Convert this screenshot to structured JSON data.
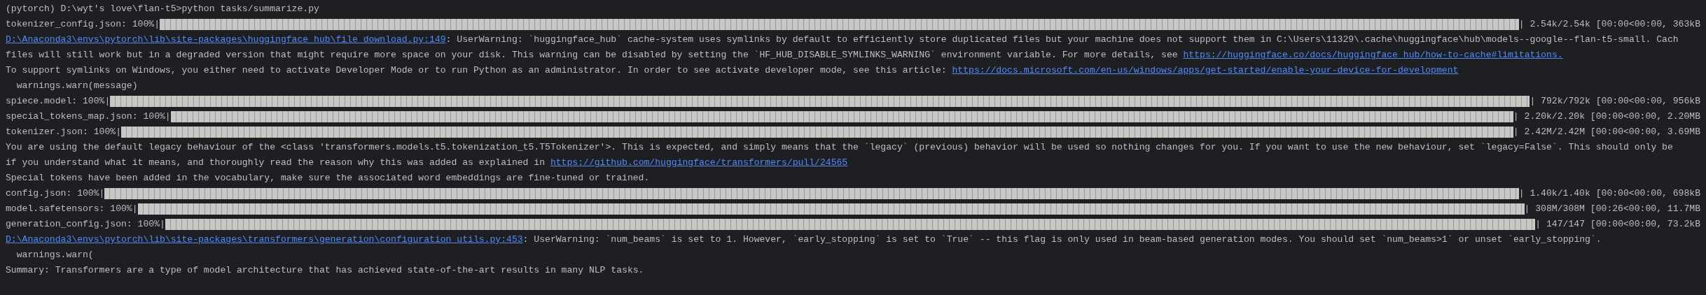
{
  "terminal": {
    "lines": [
      {
        "kind": "text",
        "segments": [
          {
            "kind": "plain",
            "text": "(pytorch) D:\\wyt's love\\flan-t5>python tasks/summarize.py"
          }
        ]
      },
      {
        "kind": "progress",
        "label": "tokenizer_config.json: 100%|",
        "level": 1,
        "stats": "| 2.54k/2.54k [00:00<00:00, 363kB"
      },
      {
        "kind": "text",
        "segments": [
          {
            "kind": "link",
            "text": "D:\\Anaconda3\\envs\\pytorch\\lib\\site-packages\\huggingface_hub\\file_download.py:149"
          },
          {
            "kind": "plain",
            "text": ": UserWarning: `huggingface_hub` cache-system uses symlinks by default to efficiently store duplicated files but your machine does not support them in C:\\Users\\11329\\.cache\\huggingface\\hub\\models--google--flan-t5-small. Cach"
          }
        ]
      },
      {
        "kind": "text",
        "segments": [
          {
            "kind": "plain",
            "text": "files will still work but in a degraded version that might require more space on your disk. This warning can be disabled by setting the `HF_HUB_DISABLE_SYMLINKS_WARNING` environment variable. For more details, see "
          },
          {
            "kind": "link",
            "text": "https://huggingface.co/docs/huggingface_hub/how-to-cache#limitations."
          }
        ]
      },
      {
        "kind": "text",
        "segments": [
          {
            "kind": "plain",
            "text": "To support symlinks on Windows, you either need to activate Developer Mode or to run Python as an administrator. In order to see activate developer mode, see this article: "
          },
          {
            "kind": "link",
            "text": "https://docs.microsoft.com/en-us/windows/apps/get-started/enable-your-device-for-development"
          }
        ]
      },
      {
        "kind": "text",
        "segments": [
          {
            "kind": "plain",
            "text": "  warnings.warn(message)"
          }
        ]
      },
      {
        "kind": "progress",
        "label": "spiece.model: 100%|",
        "level": 1,
        "stats": "| 792k/792k [00:00<00:00, 956kB"
      },
      {
        "kind": "progress",
        "label": "special_tokens_map.json: 100%|",
        "level": 1,
        "stats": "| 2.20k/2.20k [00:00<00:00, 2.20MB"
      },
      {
        "kind": "progress",
        "label": "tokenizer.json: 100%|",
        "level": 1,
        "stats": "| 2.42M/2.42M [00:00<00:00, 3.69MB"
      },
      {
        "kind": "text",
        "segments": [
          {
            "kind": "plain",
            "text": "You are using the default legacy behaviour of the <class 'transformers.models.t5.tokenization_t5.T5Tokenizer'>. This is expected, and simply means that the `legacy` (previous) behavior will be used so nothing changes for you. If you want to use the new behaviour, set `legacy=False`. This should only be"
          }
        ]
      },
      {
        "kind": "text",
        "segments": [
          {
            "kind": "plain",
            "text": "if you understand what it means, and thoroughly read the reason why this was added as explained in "
          },
          {
            "kind": "link",
            "text": "https://github.com/huggingface/transformers/pull/24565"
          }
        ]
      },
      {
        "kind": "text",
        "segments": [
          {
            "kind": "plain",
            "text": "Special tokens have been added in the vocabulary, make sure the associated word embeddings are fine-tuned or trained."
          }
        ]
      },
      {
        "kind": "progress",
        "label": "config.json: 100%|",
        "level": 1,
        "stats": "| 1.40k/1.40k [00:00<00:00, 698kB"
      },
      {
        "kind": "progress",
        "label": "model.safetensors: 100%|",
        "level": 1,
        "stats": "| 308M/308M [00:26<00:00, 11.7MB"
      },
      {
        "kind": "progress",
        "label": "generation_config.json: 100%|",
        "level": 1,
        "stats": "| 147/147 [00:00<00:00, 73.2kB"
      },
      {
        "kind": "text",
        "segments": [
          {
            "kind": "link",
            "text": "D:\\Anaconda3\\envs\\pytorch\\lib\\site-packages\\transformers\\generation\\configuration_utils.py:453"
          },
          {
            "kind": "plain",
            "text": ": UserWarning: `num_beams` is set to 1. However, `early_stopping` is set to `True` -- this flag is only used in beam-based generation modes. You should set `num_beams>1` or unset `early_stopping`."
          }
        ]
      },
      {
        "kind": "text",
        "segments": [
          {
            "kind": "plain",
            "text": "  warnings.warn("
          }
        ]
      },
      {
        "kind": "text",
        "segments": [
          {
            "kind": "plain",
            "text": "Summary: Transformers are a type of model architecture that has achieved state-of-the-art results in many NLP tasks."
          }
        ]
      }
    ]
  }
}
